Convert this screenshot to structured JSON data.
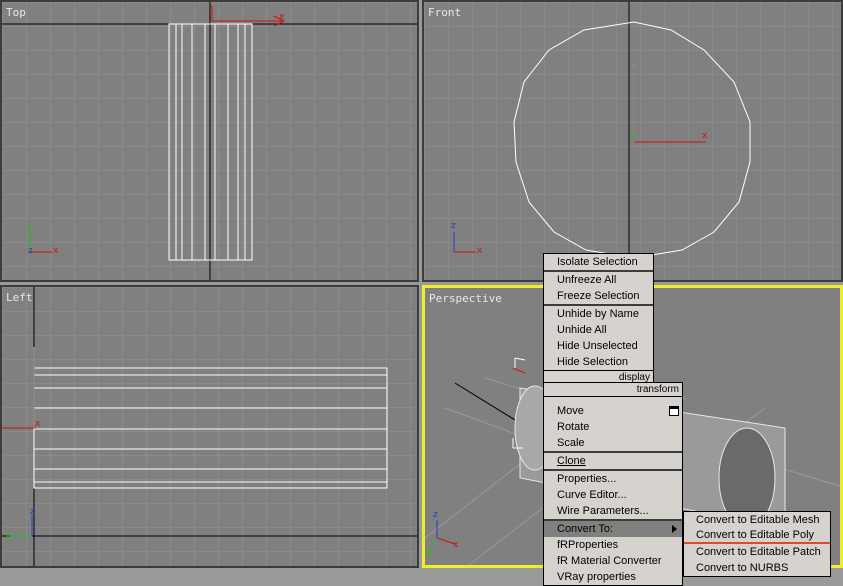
{
  "viewports": {
    "top": {
      "label": "Top"
    },
    "front": {
      "label": "Front"
    },
    "left": {
      "label": "Left"
    },
    "perspective": {
      "label": "Perspective"
    }
  },
  "axes": {
    "x": "x",
    "y": "y",
    "z": "z"
  },
  "colors": {
    "active_viewport_border": "#f0ee2a",
    "viewport_bg": "#808080",
    "axis_x": "#d01010",
    "axis_y": "#20c020",
    "axis_z": "#2040d0",
    "menu_bg": "#d6d3ce"
  },
  "quad_menu": {
    "display_items": [
      "Isolate Selection",
      "Unfreeze All",
      "Freeze Selection",
      "Unhide by Name",
      "Unhide All",
      "Hide Unselected",
      "Hide Selection"
    ],
    "display_header": "display",
    "transform_header": "transform",
    "transform_items": [
      "Move",
      "Rotate",
      "Scale",
      "Clone",
      "Properties...",
      "Curve Editor...",
      "Wire Parameters...",
      "Convert To:",
      "fRProperties",
      "fR Material Converter",
      "VRay properties"
    ],
    "submenu": [
      "Convert to Editable Mesh",
      "Convert to Editable Poly",
      "Convert to Editable Patch",
      "Convert to NURBS"
    ]
  }
}
